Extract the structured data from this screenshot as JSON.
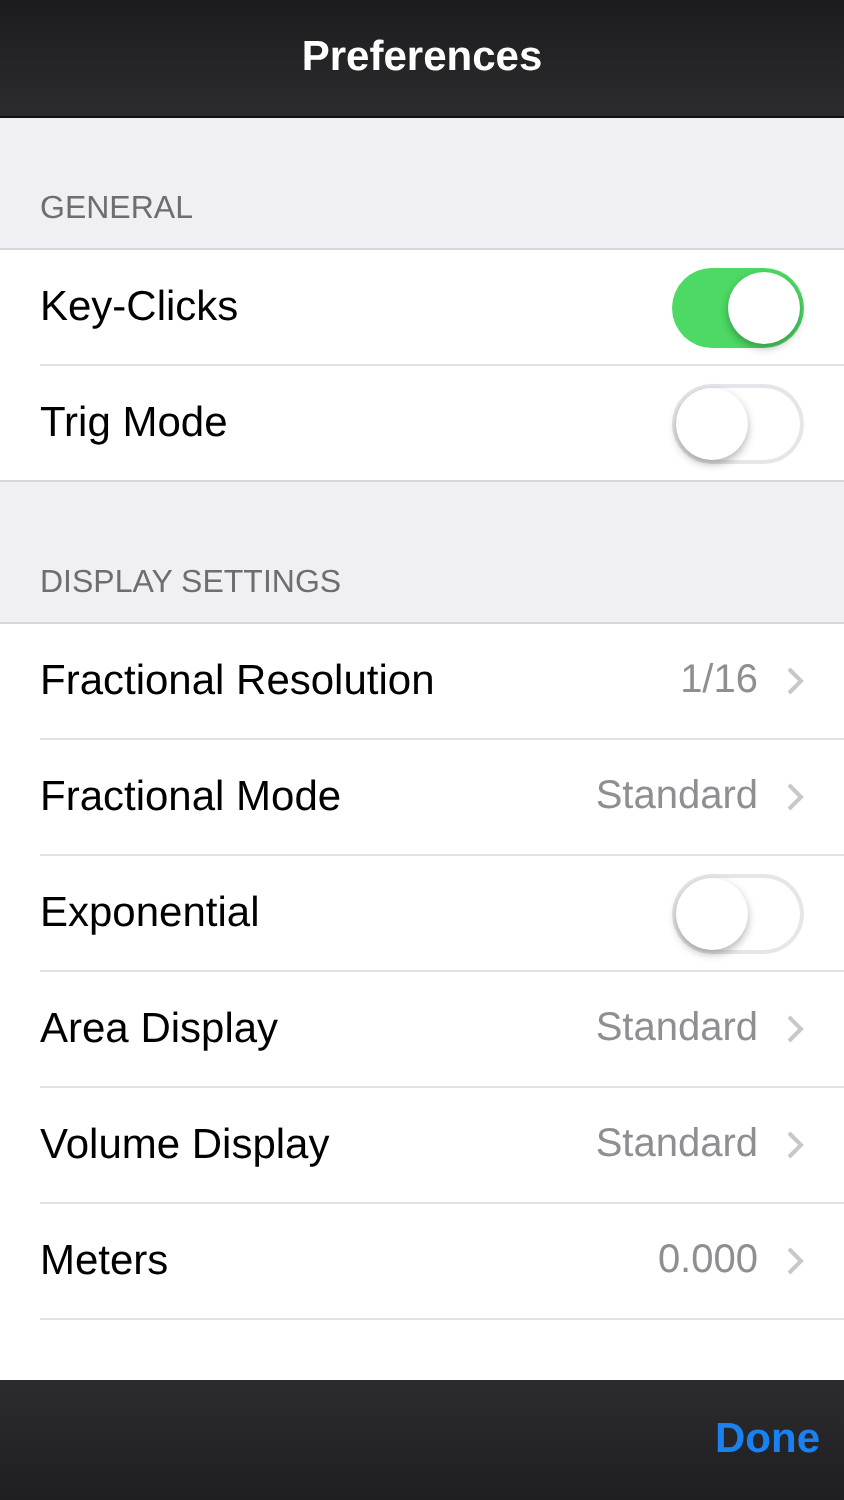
{
  "nav_bar": {
    "title": "Preferences"
  },
  "sections": [
    {
      "header": "GENERAL",
      "rows": [
        {
          "kind": "switch",
          "label": "Key-Clicks",
          "on": true
        },
        {
          "kind": "switch",
          "label": "Trig Mode",
          "on": false
        }
      ]
    },
    {
      "header": "DISPLAY SETTINGS",
      "rows": [
        {
          "kind": "detail",
          "label": "Fractional Resolution",
          "value": "1/16"
        },
        {
          "kind": "detail",
          "label": "Fractional Mode",
          "value": "Standard"
        },
        {
          "kind": "switch",
          "label": "Exponential",
          "on": false
        },
        {
          "kind": "detail",
          "label": "Area Display",
          "value": "Standard"
        },
        {
          "kind": "detail",
          "label": "Volume Display",
          "value": "Standard"
        },
        {
          "kind": "detail",
          "label": "Meters",
          "value": "0.000"
        }
      ]
    }
  ],
  "toolbar": {
    "done": "Done"
  }
}
